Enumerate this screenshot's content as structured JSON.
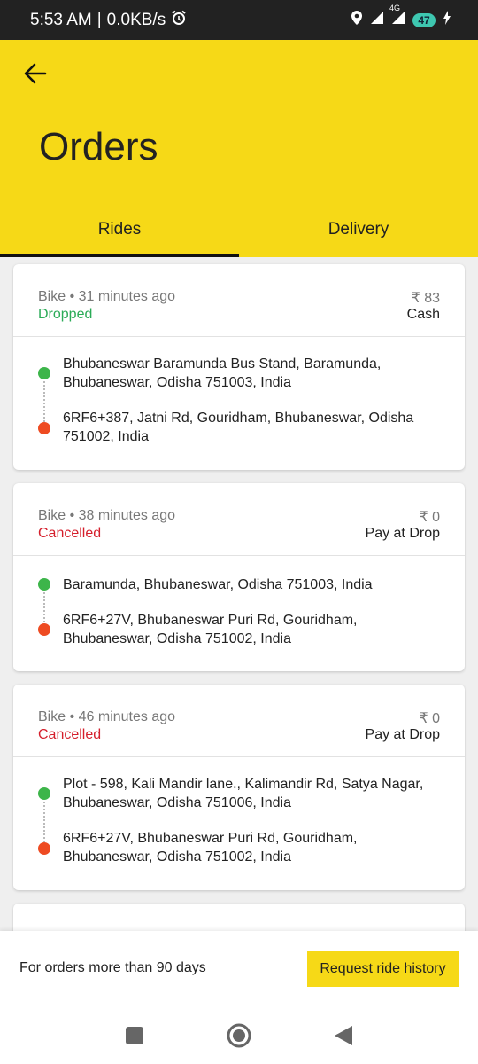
{
  "status_bar": {
    "time": "5:53 AM",
    "separator": "|",
    "speed": "0.0KB/s",
    "network": "4G",
    "battery": "47"
  },
  "header": {
    "title": "Orders",
    "tabs": [
      {
        "label": "Rides",
        "active": true
      },
      {
        "label": "Delivery",
        "active": false
      }
    ]
  },
  "orders": [
    {
      "vehicle": "Bike",
      "time": "31 minutes ago",
      "status": "Dropped",
      "amount": "₹ 83",
      "payment": "Cash",
      "pickup": "Bhubaneswar Baramunda Bus Stand, Baramunda, Bhubaneswar, Odisha 751003, India",
      "drop": "6RF6+387, Jatni Rd, Gouridham, Bhubaneswar, Odisha 751002, India"
    },
    {
      "vehicle": "Bike",
      "time": "38 minutes ago",
      "status": "Cancelled",
      "amount": "₹ 0",
      "payment": "Pay at Drop",
      "pickup": "Baramunda, Bhubaneswar, Odisha 751003, India",
      "drop": "6RF6+27V, Bhubaneswar Puri Rd, Gouridham, Bhubaneswar, Odisha 751002, India"
    },
    {
      "vehicle": "Bike",
      "time": "46 minutes ago",
      "status": "Cancelled",
      "amount": "₹ 0",
      "payment": "Pay at Drop",
      "pickup": "Plot - 598, Kali Mandir lane., Kalimandir Rd, Satya Nagar, Bhubaneswar, Odisha 751006, India",
      "drop": "6RF6+27V, Bhubaneswar Puri Rd, Gouridham, Bhubaneswar, Odisha 751002, India"
    }
  ],
  "bottom_bar": {
    "text": "For orders more than 90 days",
    "button_label": "Request ride history"
  },
  "colors": {
    "brand_yellow": "#f6d917",
    "dropped_green": "#2bab57",
    "cancelled_red": "#d51f2c",
    "pickup_dot": "#3db54a",
    "drop_dot": "#ee4b22"
  },
  "icons": {
    "back": "arrow-left-icon",
    "alarm": "alarm-icon",
    "location": "location-icon",
    "signal": "signal-icon",
    "charging": "charging-icon",
    "nav_recents": "square-icon",
    "nav_home": "circle-icon",
    "nav_back": "triangle-icon"
  }
}
